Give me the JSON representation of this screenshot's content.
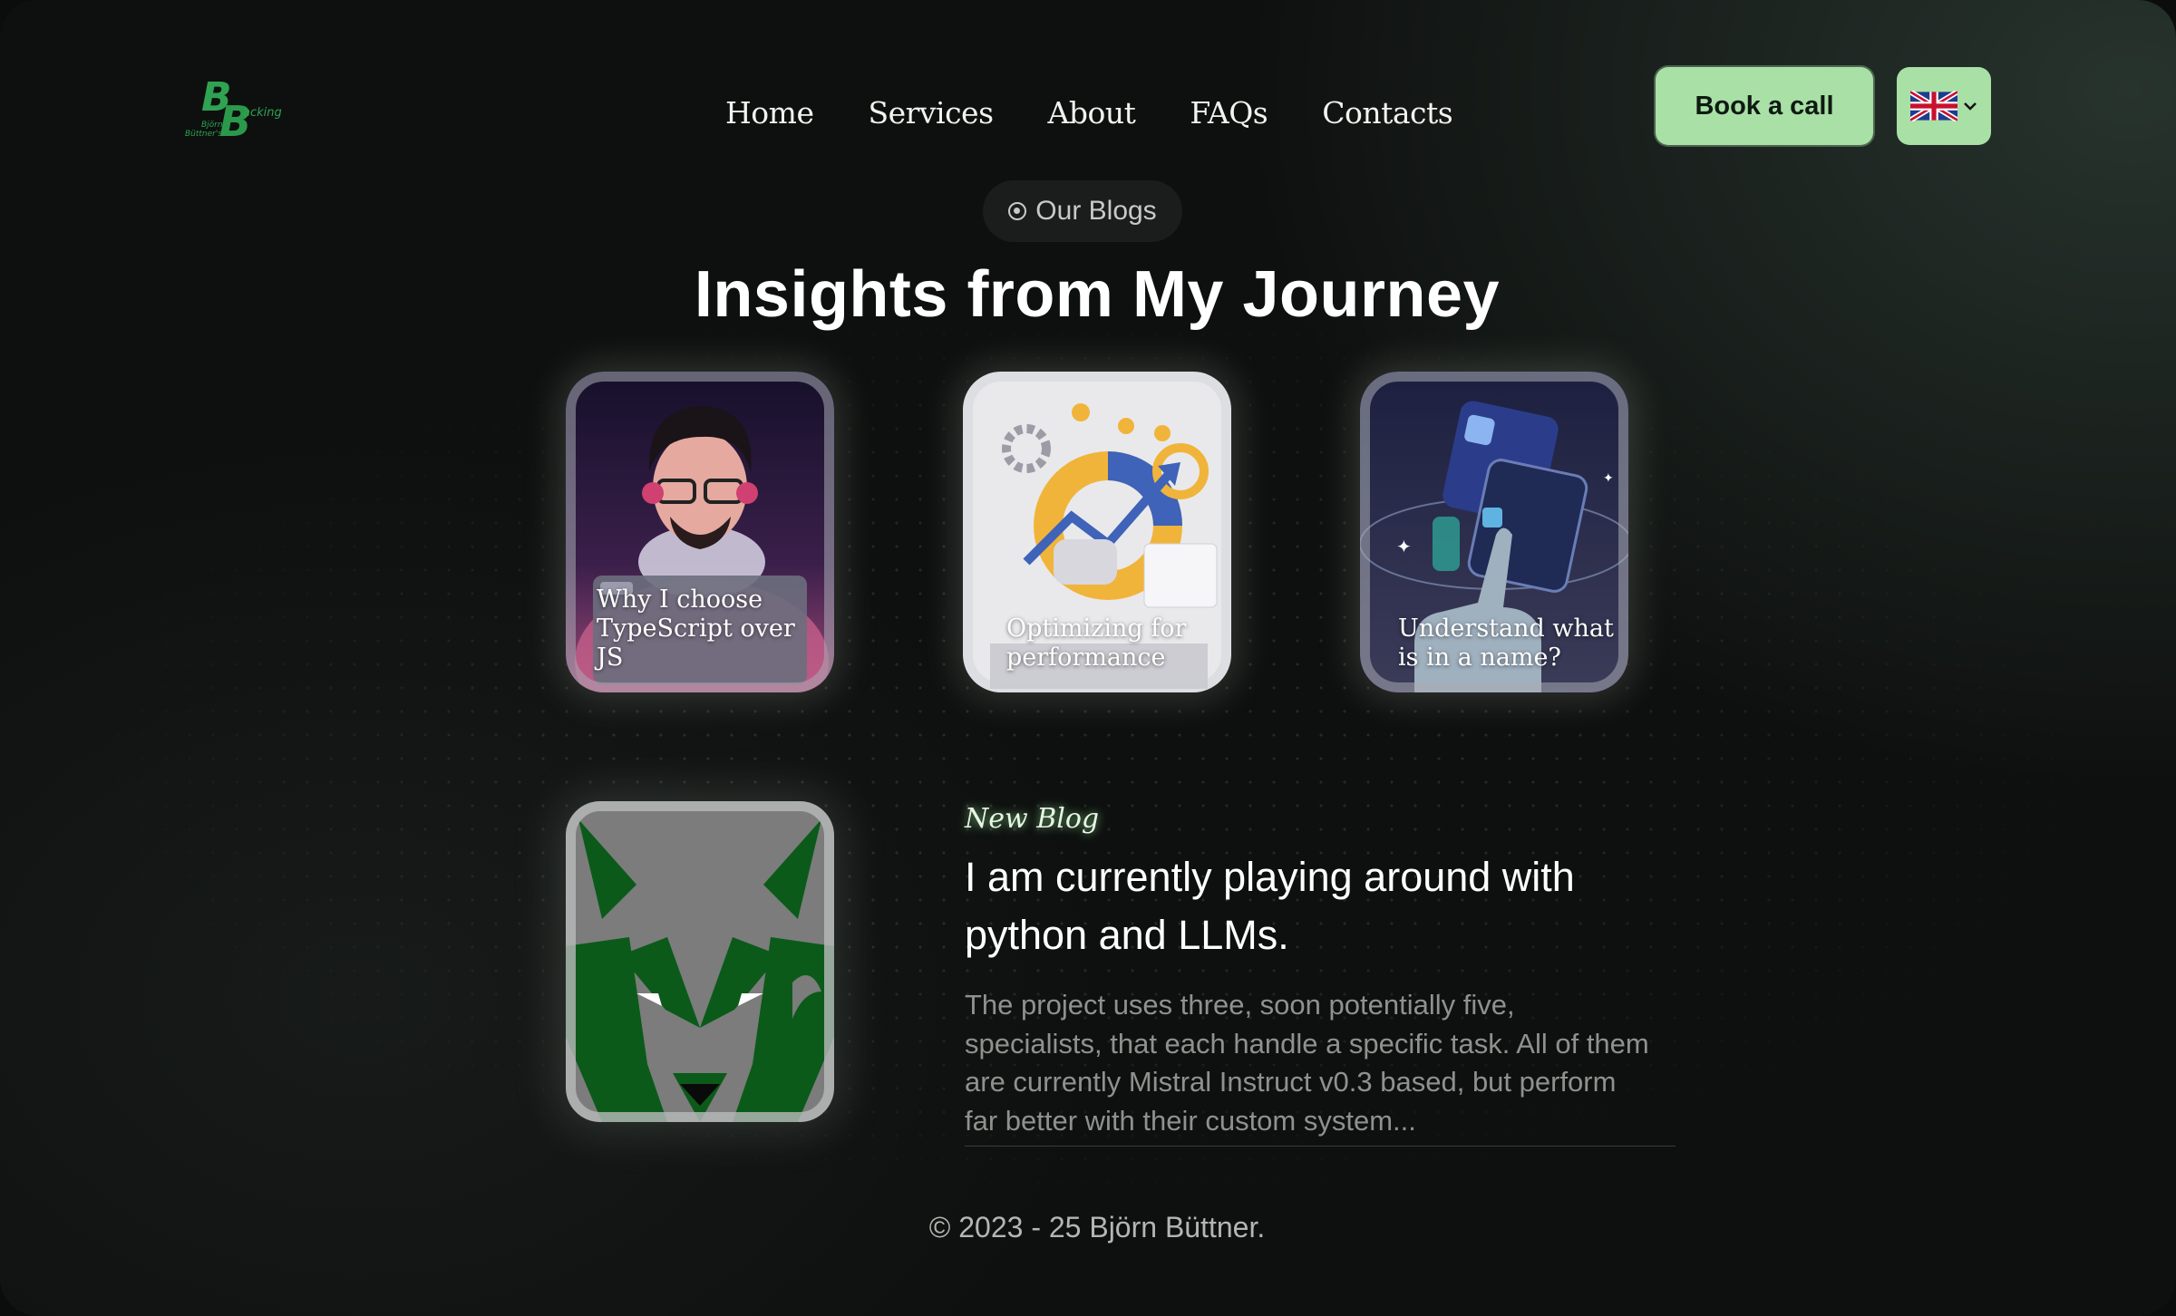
{
  "brand": {
    "logo_text": "Björn Büttner's Backing",
    "accent_color": "#a8e0a6",
    "logo_color": "#2fa352"
  },
  "nav": {
    "items": [
      {
        "label": "Home"
      },
      {
        "label": "Services"
      },
      {
        "label": "About"
      },
      {
        "label": "FAQs"
      },
      {
        "label": "Contacts"
      }
    ]
  },
  "header": {
    "book_call_label": "Book a call",
    "language_icon": "uk-flag-icon"
  },
  "section": {
    "pill_label": "Our Blogs",
    "headline": "Insights from My Journey"
  },
  "blog_cards": [
    {
      "title": "Why I choose TypeScript over JS"
    },
    {
      "title": "Optimizing for performance"
    },
    {
      "title": "Understand what is in a name?"
    }
  ],
  "new_blog": {
    "label": "New Blog",
    "title": "I am currently playing around with python and LLMs.",
    "excerpt": "The project uses three, soon potentially five, specialists, that each handle a specific task. All of them are currently Mistral Instruct v0.3 based, but perform far better with their custom system..."
  },
  "footer": {
    "copyright": "© 2023 - 25 Björn Büttner."
  }
}
